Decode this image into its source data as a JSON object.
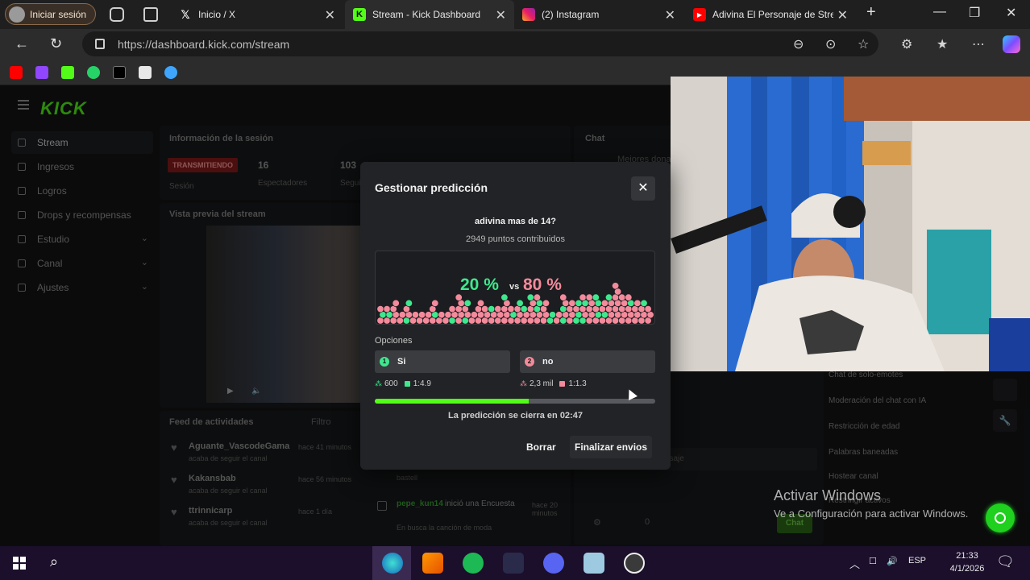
{
  "browser": {
    "profile_label": "Iniciar sesión",
    "tabs": [
      {
        "title": "Inicio / X",
        "icon": "x-logo-icon"
      },
      {
        "title": "Stream - Kick Dashboard",
        "icon": "kick-logo-icon",
        "active": true
      },
      {
        "title": "(2) Instagram",
        "icon": "instagram-icon"
      },
      {
        "title": "Adivina El Personaje de Strea",
        "icon": "youtube-icon"
      }
    ],
    "url": "https://dashboard.kick.com/stream",
    "bookmarks": [
      "youtube",
      "twitch",
      "kick",
      "whatsapp",
      "x",
      "notion",
      "cloud"
    ]
  },
  "kick": {
    "logo": "KICK",
    "sidebar": [
      {
        "label": "Stream",
        "active": true
      },
      {
        "label": "Ingresos"
      },
      {
        "label": "Logros"
      },
      {
        "label": "Drops y recompensas"
      },
      {
        "label": "Estudio",
        "expand": true
      },
      {
        "label": "Canal",
        "expand": true
      },
      {
        "label": "Ajustes",
        "expand": true
      }
    ],
    "session": {
      "title": "Información de la sesión",
      "badge": "TRANSMITIENDO",
      "badge_sub": "Sesión",
      "stat1_value": "16",
      "stat1_label": "Espectadores",
      "stat2_value": "103",
      "stat2_label": "Segui"
    },
    "preview_title": "Vista previa del stream",
    "feed": {
      "title": "Feed de actividades",
      "filter": "Filtro",
      "items": [
        {
          "user": "Aguante_VascodeGama",
          "text": "acaba de seguir el canal",
          "time": "hace 41 minutos"
        },
        {
          "user": "Kakansbab",
          "text": "acaba de seguir el canal",
          "time": "hace 56 minutos"
        },
        {
          "user": "ttrinnicarp",
          "text": "acaba de seguir el canal",
          "time": "hace 1 día"
        }
      ],
      "poll_user": "pepe_kun14",
      "poll_text": "inició una Encuesta",
      "poll_time": "hace 20 minutos",
      "poll_sub": "En busca la canción de moda",
      "poll_prev": "bastell"
    },
    "chat": {
      "title": "Chat",
      "top_donors": "Mejores dona",
      "input_placeholder": "Enviar un mensaje",
      "send": "Chat",
      "count": "0"
    },
    "settings_list": [
      "Chat de solo-emotes",
      "Moderación del chat con IA",
      "Restricción de edad",
      "Palabras baneadas",
      "Hostear canal",
      "Restringir activos"
    ]
  },
  "modal": {
    "title": "Gestionar predicción",
    "question": "adivina mas de 14?",
    "points": "2949 puntos contribuidos",
    "pct_a": "20 %",
    "vs": "vs",
    "pct_b": "80 %",
    "options_label": "Opciones",
    "option_a": {
      "label": "Si",
      "points": "600",
      "ratio": "1:4.9"
    },
    "option_b": {
      "label": "no",
      "points": "2,3 mil",
      "ratio": "1:1.3"
    },
    "progress": 0.55,
    "closes_text": "La predicción se cierra en 02:47",
    "delete_label": "Borrar",
    "finish_label": "Finalizar envios",
    "colors": {
      "yes": "#3ee88e",
      "no": "#f48a9b",
      "accent": "#53fc18"
    }
  },
  "watermark": {
    "line1": "Activar Windows",
    "line2": "Ve a Configuración para activar Windows."
  },
  "taskbar": {
    "lang": "ESP",
    "time": "21:33",
    "date": "4/1/2026"
  }
}
